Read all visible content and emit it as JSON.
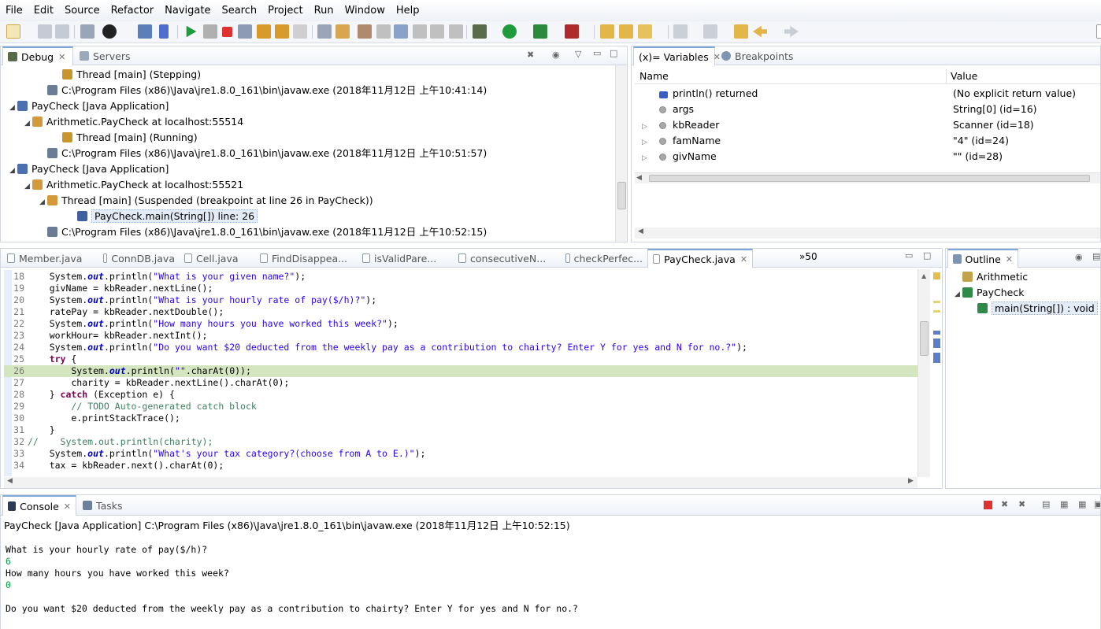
{
  "menu": [
    "File",
    "Edit",
    "Source",
    "Refactor",
    "Navigate",
    "Search",
    "Project",
    "Run",
    "Window",
    "Help"
  ],
  "debug_view": {
    "tabs": [
      {
        "label": "Debug",
        "active": true
      },
      {
        "label": "Servers",
        "active": false
      }
    ],
    "tree": [
      {
        "indent": 4,
        "tri": "",
        "icon": "thread-icon",
        "text": "Thread [main] (Stepping)"
      },
      {
        "indent": 3,
        "tri": "",
        "icon": "process-icon",
        "text": "C:\\Program Files (x86)\\Java\\jre1.8.0_161\\bin\\javaw.exe (2018年11月12日 上午10:41:14)"
      },
      {
        "indent": 1,
        "tri": "◢",
        "icon": "java-app-icon",
        "text": "PayCheck [Java Application]"
      },
      {
        "indent": 2,
        "tri": "◢",
        "icon": "vm-icon",
        "text": "Arithmetic.PayCheck at localhost:55514"
      },
      {
        "indent": 4,
        "tri": "",
        "icon": "thread-icon",
        "text": "Thread [main] (Running)"
      },
      {
        "indent": 3,
        "tri": "",
        "icon": "process-icon",
        "text": "C:\\Program Files (x86)\\Java\\jre1.8.0_161\\bin\\javaw.exe (2018年11月12日 上午10:51:57)"
      },
      {
        "indent": 1,
        "tri": "◢",
        "icon": "java-app-icon",
        "text": "PayCheck [Java Application]"
      },
      {
        "indent": 2,
        "tri": "◢",
        "icon": "vm-icon",
        "text": "Arithmetic.PayCheck at localhost:55521"
      },
      {
        "indent": 3,
        "tri": "◢",
        "icon": "thread-suspended-icon",
        "text": "Thread [main] (Suspended (breakpoint at line 26 in PayCheck))"
      },
      {
        "indent": 5,
        "tri": "",
        "icon": "stack-frame-icon",
        "text": "PayCheck.main(String[]) line: 26",
        "selected": true
      },
      {
        "indent": 3,
        "tri": "",
        "icon": "process-icon",
        "text": "C:\\Program Files (x86)\\Java\\jre1.8.0_161\\bin\\javaw.exe (2018年11月12日 上午10:52:15)"
      }
    ]
  },
  "variables_view": {
    "tabs": [
      {
        "label": "(x)= Variables",
        "active": true
      },
      {
        "label": "Breakpoints",
        "active": false
      }
    ],
    "headers": {
      "name": "Name",
      "value": "Value"
    },
    "rows": [
      {
        "expand": "",
        "icon": "return-icon",
        "name": "println() returned",
        "value": "(No explicit return value)"
      },
      {
        "expand": "",
        "icon": "local-var-icon",
        "name": "args",
        "value": "String[0]  (id=16)"
      },
      {
        "expand": "▷",
        "icon": "local-var-icon",
        "name": "kbReader",
        "value": "Scanner  (id=18)"
      },
      {
        "expand": "▷",
        "icon": "local-var-icon",
        "name": "famName",
        "value": "\"4\" (id=24)"
      },
      {
        "expand": "▷",
        "icon": "local-var-icon",
        "name": "givName",
        "value": "\"\" (id=28)"
      }
    ]
  },
  "editor": {
    "tabs": [
      "Member.java",
      "ConnDB.java",
      "Cell.java",
      "FindDisappea...",
      "isValidPare...",
      "consecutiveN...",
      "checkPerfec...",
      "PayCheck.java"
    ],
    "active_tab": "PayCheck.java",
    "overflow_count": "»50",
    "current_line": 26,
    "lines": [
      {
        "n": "18",
        "html": "    System.<span class=\"fld\">out</span>.println(<span class=\"str\">\"What is your given name?\"</span>);"
      },
      {
        "n": "19",
        "html": "    givName = kbReader.nextLine();"
      },
      {
        "n": "20",
        "html": "    System.<span class=\"fld\">out</span>.println(<span class=\"str\">\"What is your hourly rate of pay($/h)?\"</span>);"
      },
      {
        "n": "21",
        "html": "    ratePay = kbReader.nextDouble();"
      },
      {
        "n": "22",
        "html": "    System.<span class=\"fld\">out</span>.println(<span class=\"str\">\"How many hours you have worked this week?\"</span>);"
      },
      {
        "n": "23",
        "html": "    workHour= kbReader.nextInt();"
      },
      {
        "n": "24",
        "html": "    System.<span class=\"fld\">out</span>.println(<span class=\"str\">\"Do you want $20 deducted from the weekly pay as a contribution to chairty? Enter Y for yes and N for no.?\"</span>);"
      },
      {
        "n": "25",
        "html": "    <span class=\"kw\">try</span> {"
      },
      {
        "n": "26",
        "html": "        System.<span class=\"fld\">out</span>.println(<span class=\"str\">\"\"</span>.charAt(0));"
      },
      {
        "n": "27",
        "html": "        charity = kbReader.nextLine().charAt(0);"
      },
      {
        "n": "28",
        "html": "    } <span class=\"kw\">catch</span> (Exception e) {"
      },
      {
        "n": "29",
        "html": "        <span class=\"cmt\">// TODO Auto-generated catch block</span>"
      },
      {
        "n": "30",
        "html": "        e.printStackTrace();"
      },
      {
        "n": "31",
        "html": "    }"
      },
      {
        "n": "32",
        "html": "<span class=\"cmt\">//    System.out.println(charity);</span>"
      },
      {
        "n": "33",
        "html": "    System.<span class=\"fld\">out</span>.println(<span class=\"str\">\"What's your tax category?(choose from A to E.)\"</span>);"
      },
      {
        "n": "34",
        "html": "    tax = kbReader.next().charAt(0);"
      }
    ]
  },
  "outline_view": {
    "tab": "Outline",
    "items": [
      {
        "indent": 1,
        "tri": "",
        "icon": "package-icon",
        "text": "Arithmetic"
      },
      {
        "indent": 1,
        "tri": "◢",
        "icon": "class-icon",
        "text": "PayCheck"
      },
      {
        "indent": 2,
        "tri": "",
        "icon": "method-icon",
        "text": "main(String[]) : void",
        "selected": true
      }
    ]
  },
  "console_view": {
    "tabs": [
      {
        "label": "Console",
        "active": true
      },
      {
        "label": "Tasks",
        "active": false
      }
    ],
    "launch": "PayCheck [Java Application] C:\\Program Files (x86)\\Java\\jre1.8.0_161\\bin\\javaw.exe (2018年11月12日 上午10:52:15)",
    "lines": [
      {
        "text": "What is your hourly rate of pay($/h)?",
        "input": false
      },
      {
        "text": "6",
        "input": true
      },
      {
        "text": "How many hours you have worked this week?",
        "input": false
      },
      {
        "text": "0",
        "input": true
      },
      {
        "text": "",
        "input": false
      },
      {
        "text": "Do you want $20 deducted from the weekly pay as a contribution to chairty? Enter Y for yes and N for no.?",
        "input": false
      }
    ]
  },
  "colors": {
    "accent": "#7fa7d9",
    "current_line": "#d4e6c0",
    "input_text": "#00a040"
  }
}
